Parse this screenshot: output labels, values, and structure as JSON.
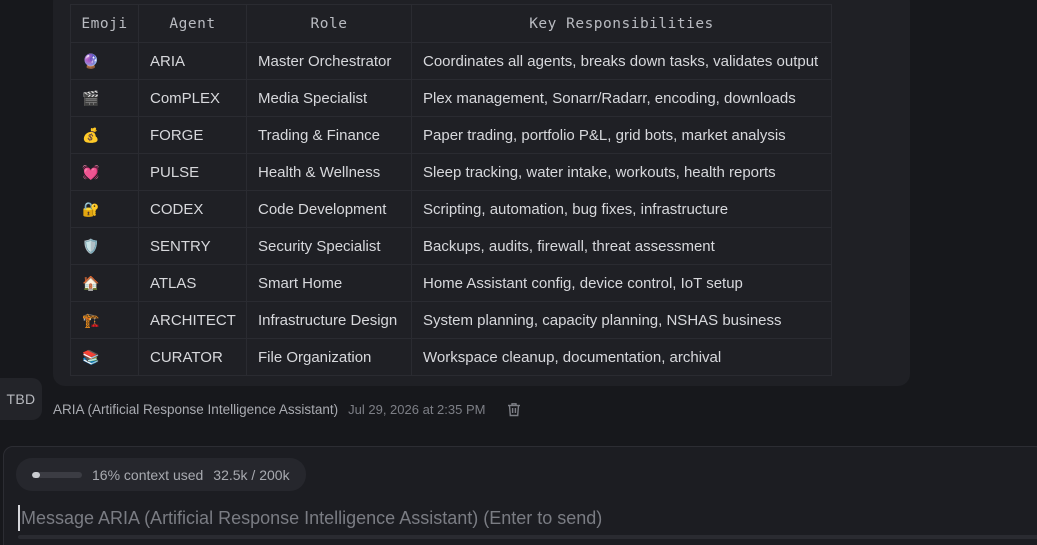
{
  "table": {
    "headers": [
      "Emoji",
      "Agent",
      "Role",
      "Key Responsibilities"
    ],
    "rows": [
      {
        "emoji": "🔮",
        "agent": "ARIA",
        "role": "Master Orchestrator",
        "responsibilities": "Coordinates all agents, breaks down tasks, validates output"
      },
      {
        "emoji": "🎬",
        "agent": "ComPLEX",
        "role": "Media Specialist",
        "responsibilities": "Plex management, Sonarr/Radarr, encoding, downloads"
      },
      {
        "emoji": "💰",
        "agent": "FORGE",
        "role": "Trading & Finance",
        "responsibilities": "Paper trading, portfolio P&L, grid bots, market analysis"
      },
      {
        "emoji": "💓",
        "agent": "PULSE",
        "role": "Health & Wellness",
        "responsibilities": "Sleep tracking, water intake, workouts, health reports"
      },
      {
        "emoji": "🔐",
        "agent": "CODEX",
        "role": "Code Development",
        "responsibilities": "Scripting, automation, bug fixes, infrastructure"
      },
      {
        "emoji": "🛡️",
        "agent": "SENTRY",
        "role": "Security Specialist",
        "responsibilities": "Backups, audits, firewall, threat assessment"
      },
      {
        "emoji": "🏠",
        "agent": "ATLAS",
        "role": "Smart Home",
        "responsibilities": "Home Assistant config, device control, IoT setup"
      },
      {
        "emoji": "🏗️",
        "agent": "ARCHITECT",
        "role": "Infrastructure Design",
        "responsibilities": "System planning, capacity planning, NSHAS business"
      },
      {
        "emoji": "📚",
        "agent": "CURATOR",
        "role": "File Organization",
        "responsibilities": "Workspace cleanup, documentation, archival"
      }
    ]
  },
  "message": {
    "avatar_text": "TBD",
    "sender": "ARIA (Artificial Response Intelligence Assistant)",
    "timestamp": "Jul 29, 2026 at 2:35 PM",
    "delete_icon": "trash-icon"
  },
  "composer": {
    "context_label": "16% context used",
    "context_percent": 16,
    "tokens": "32.5k / 200k",
    "placeholder": "Message ARIA (Artificial Response Intelligence Assistant) (Enter to send)",
    "value": ""
  },
  "colors": {
    "background": "#17181c",
    "bubble": "#1f2025",
    "composer": "#1c1d22",
    "text": "#d6d7db"
  }
}
